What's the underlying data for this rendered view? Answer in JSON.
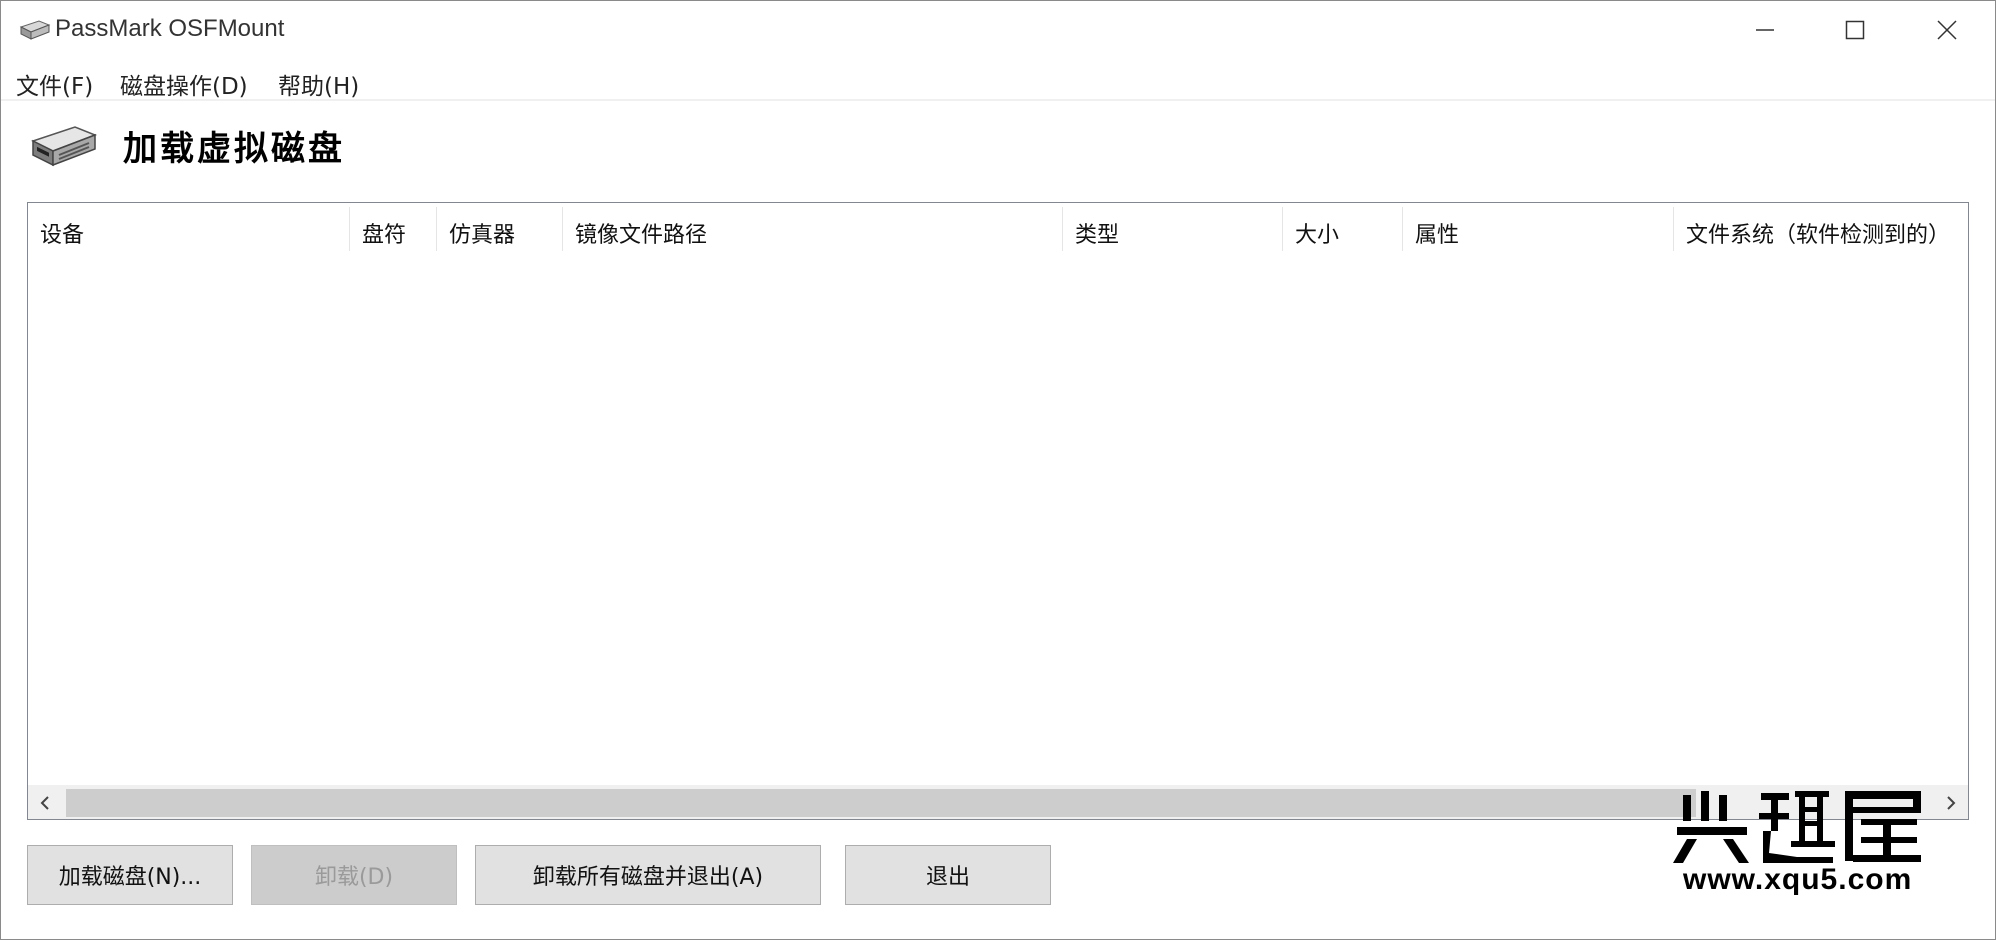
{
  "window": {
    "title": "PassMark OSFMount"
  },
  "menu": {
    "file": "文件(F)",
    "disk_ops": "磁盘操作(D)",
    "help": "帮助(H)"
  },
  "header": {
    "title": "加载虚拟磁盘"
  },
  "table": {
    "columns": [
      "设备",
      "盘符",
      "仿真器",
      "镜像文件路径",
      "类型",
      "大小",
      "属性",
      "文件系统（软件检测到的）"
    ],
    "rows": []
  },
  "buttons": {
    "mount": "加载磁盘(N)...",
    "unmount": "卸载(D)",
    "unmount_all_exit": "卸载所有磁盘并退出(A)",
    "exit": "退出"
  },
  "watermark": {
    "logo_text": "兴趣屋",
    "url": "www.xqu5.com"
  },
  "icons": {
    "app": "disk-drive-icon",
    "header": "disk-drive-icon",
    "minimize": "minimize-icon",
    "maximize": "maximize-icon",
    "close": "close-icon",
    "scroll_left": "chevron-left-icon",
    "scroll_right": "chevron-right-icon"
  }
}
